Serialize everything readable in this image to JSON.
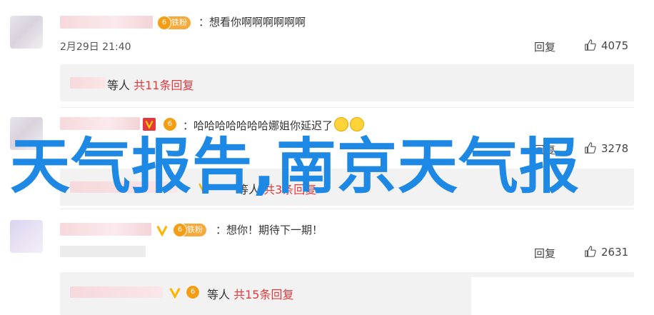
{
  "comments": [
    {
      "text": "：想看你啊啊啊啊啊啊",
      "badge": "铁粉",
      "badge_level": "6",
      "time": "2月29日 21:40",
      "reply_label": "回复",
      "likes": "4075",
      "sub": {
        "prefix": "等人",
        "count": "共11条回复"
      }
    },
    {
      "text": "：哈哈哈哈哈哈哈娜姐你延迟了",
      "badge": "",
      "badge_level": "6",
      "time": "",
      "reply_label": "回复",
      "likes": "3278",
      "sub": {
        "prefix": "等人",
        "count": "共3条回复"
      }
    },
    {
      "text": "：想你！期待下一期！",
      "badge": "铁粉",
      "badge_level": "6",
      "time": "",
      "reply_label": "回复",
      "likes": "2631",
      "sub": {
        "prefix": "等人",
        "count": "共15条回复"
      }
    }
  ],
  "overlay_text": "天气报告,南京天气报",
  "colors": {
    "accent": "#e4393c",
    "overlay": "#1e88e5",
    "fan": "#f7a93a"
  }
}
